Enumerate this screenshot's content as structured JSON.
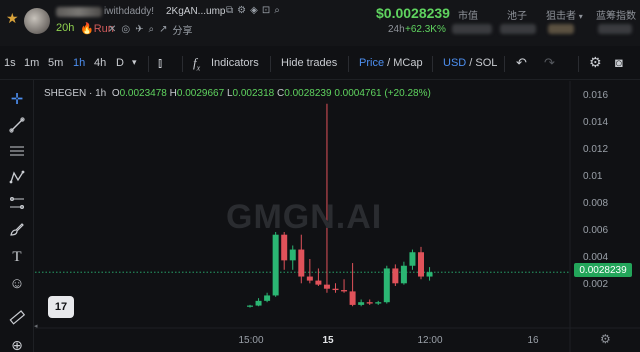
{
  "header": {
    "handle": "iwithdaddy!",
    "mint": "2KgAN...ump",
    "age": "20h",
    "run_label": "Run",
    "share_label": "分享",
    "price": "$0.0028239",
    "change_label": "24h",
    "change": "+62.3K%",
    "stats": [
      "市值",
      "池子",
      "狙击者",
      "蓝筹指数"
    ]
  },
  "toolbar": {
    "intervals": [
      "1s",
      "1m",
      "5m",
      "1h",
      "4h",
      "D"
    ],
    "active_interval": "1h",
    "indicators_label": "Indicators",
    "hide_trades_label": "Hide trades",
    "price_label": "Price",
    "mcap_label": "MCap",
    "usd_label": "USD",
    "sol_label": "SOL"
  },
  "legend": {
    "symbol": "SHEGEN · 1h",
    "o_label": "O",
    "o": "0.0023478",
    "h_label": "H",
    "h": "0.0029667",
    "l_label": "L",
    "l": "0.002318",
    "c_label": "C",
    "c": "0.0028239",
    "delta": "0.0004761",
    "pct": "(+20.28%)"
  },
  "watermark": "GMGN.AI",
  "tv_logo": "17",
  "current_price_tag": "0.0028239",
  "chart_data": {
    "type": "candlestick",
    "y_ticks": [
      "0.016",
      "0.014",
      "0.012",
      "0.01",
      "0.008",
      "0.006",
      "0.004",
      "0.002"
    ],
    "x_ticks": [
      "15:00",
      "15",
      "12:00",
      "16"
    ],
    "ylim": [
      0,
      0.0166
    ],
    "last_price": 0.0028239,
    "up_color": "#2bb673",
    "down_color": "#e0525a",
    "candles": [
      {
        "o": 0.0003,
        "h": 0.0004,
        "l": 0.0002,
        "c": 0.00035
      },
      {
        "o": 0.00035,
        "h": 0.0009,
        "l": 0.0003,
        "c": 0.0007
      },
      {
        "o": 0.0007,
        "h": 0.0013,
        "l": 0.0006,
        "c": 0.0011
      },
      {
        "o": 0.0011,
        "h": 0.0058,
        "l": 0.001,
        "c": 0.0056
      },
      {
        "o": 0.0056,
        "h": 0.0058,
        "l": 0.003,
        "c": 0.0037
      },
      {
        "o": 0.0037,
        "h": 0.0048,
        "l": 0.003,
        "c": 0.0045
      },
      {
        "o": 0.0045,
        "h": 0.0056,
        "l": 0.002,
        "c": 0.0025
      },
      {
        "o": 0.0025,
        "h": 0.0038,
        "l": 0.002,
        "c": 0.0022
      },
      {
        "o": 0.0022,
        "h": 0.0031,
        "l": 0.0018,
        "c": 0.0019
      },
      {
        "o": 0.0019,
        "h": 0.0153,
        "l": 0.0013,
        "c": 0.0016
      },
      {
        "o": 0.0016,
        "h": 0.002,
        "l": 0.0013,
        "c": 0.0015
      },
      {
        "o": 0.0015,
        "h": 0.0023,
        "l": 0.0013,
        "c": 0.0014
      },
      {
        "o": 0.0014,
        "h": 0.0035,
        "l": 0.0003,
        "c": 0.0004
      },
      {
        "o": 0.0004,
        "h": 0.0008,
        "l": 0.0003,
        "c": 0.0006
      },
      {
        "o": 0.0006,
        "h": 0.0008,
        "l": 0.0004,
        "c": 0.0005
      },
      {
        "o": 0.0005,
        "h": 0.0007,
        "l": 0.0004,
        "c": 0.0006
      },
      {
        "o": 0.0006,
        "h": 0.0033,
        "l": 0.0005,
        "c": 0.0031
      },
      {
        "o": 0.0031,
        "h": 0.0034,
        "l": 0.0018,
        "c": 0.002
      },
      {
        "o": 0.002,
        "h": 0.0036,
        "l": 0.0019,
        "c": 0.0033
      },
      {
        "o": 0.0033,
        "h": 0.0045,
        "l": 0.003,
        "c": 0.0043
      },
      {
        "o": 0.0043,
        "h": 0.0047,
        "l": 0.0023,
        "c": 0.0025
      },
      {
        "o": 0.0025,
        "h": 0.0032,
        "l": 0.0022,
        "c": 0.00282
      }
    ]
  }
}
